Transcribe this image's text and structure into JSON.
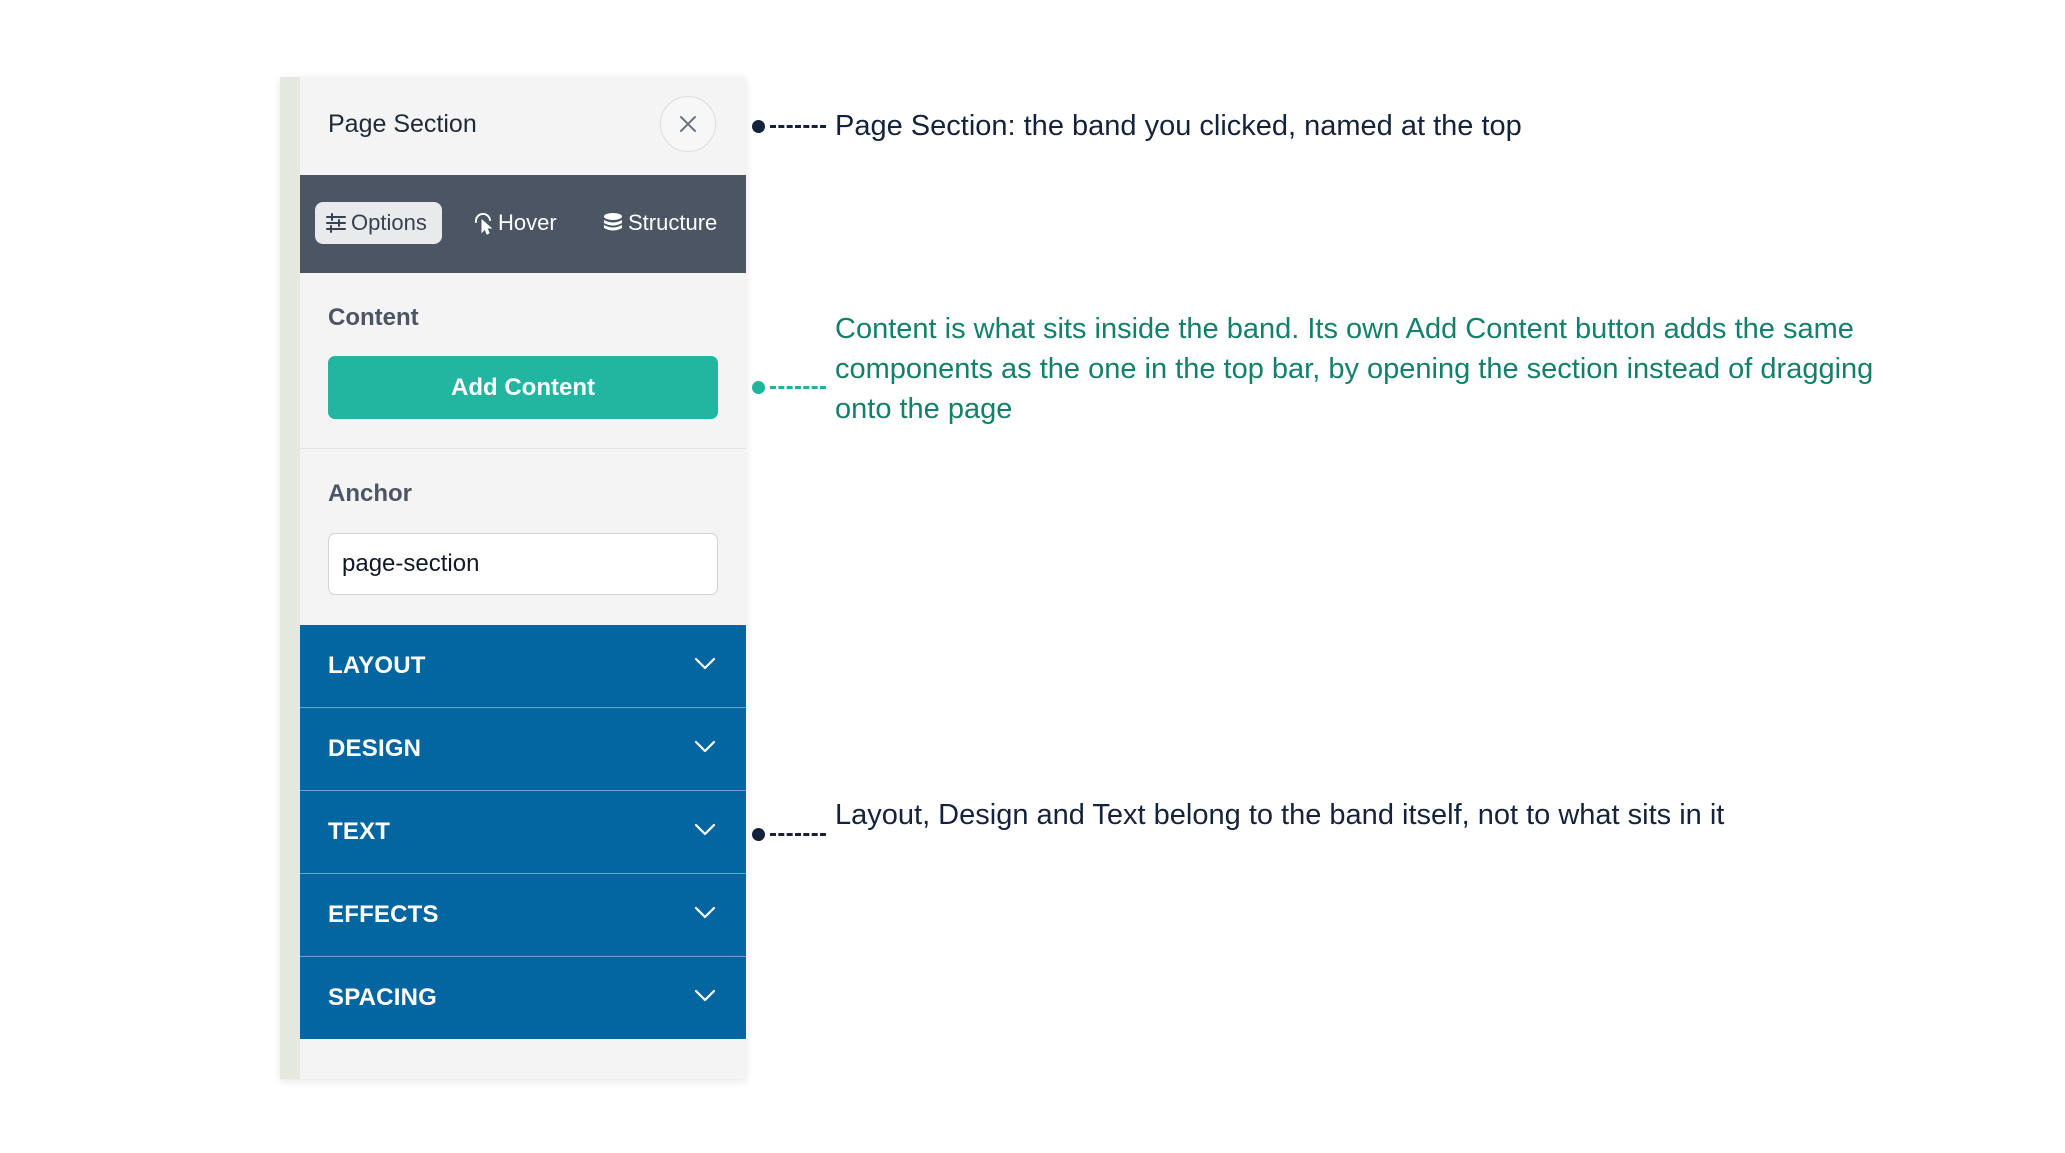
{
  "panel": {
    "title": "Page Section",
    "close_icon": "close-icon",
    "tabs": [
      {
        "label": "Options",
        "icon": "sliders-icon",
        "active": true
      },
      {
        "label": "Hover",
        "icon": "pointer-icon",
        "active": false
      },
      {
        "label": "Structure",
        "icon": "layers-icon",
        "active": false
      }
    ],
    "content": {
      "label": "Content",
      "add_button": "Add Content"
    },
    "anchor": {
      "label": "Anchor",
      "value": "page-section"
    },
    "accordion": [
      {
        "label": "LAYOUT"
      },
      {
        "label": "DESIGN"
      },
      {
        "label": "TEXT"
      },
      {
        "label": "EFFECTS"
      },
      {
        "label": "SPACING"
      }
    ]
  },
  "annotations": [
    {
      "text": "Page Section: the band you clicked, named at the top",
      "color": "#14233b"
    },
    {
      "text": "Content is what sits inside the band. Its own Add Content button adds the same components as the one in the top bar, by opening the section instead of dragging onto the page",
      "color": "#13806b"
    },
    {
      "text": "Layout, Design and Text belong to the band itself, not to what sits in it",
      "color": "#14233b"
    }
  ],
  "colors": {
    "tabbar": "#4b5563",
    "accent_teal": "#22b5a0",
    "accordion_blue": "#0466a1"
  }
}
